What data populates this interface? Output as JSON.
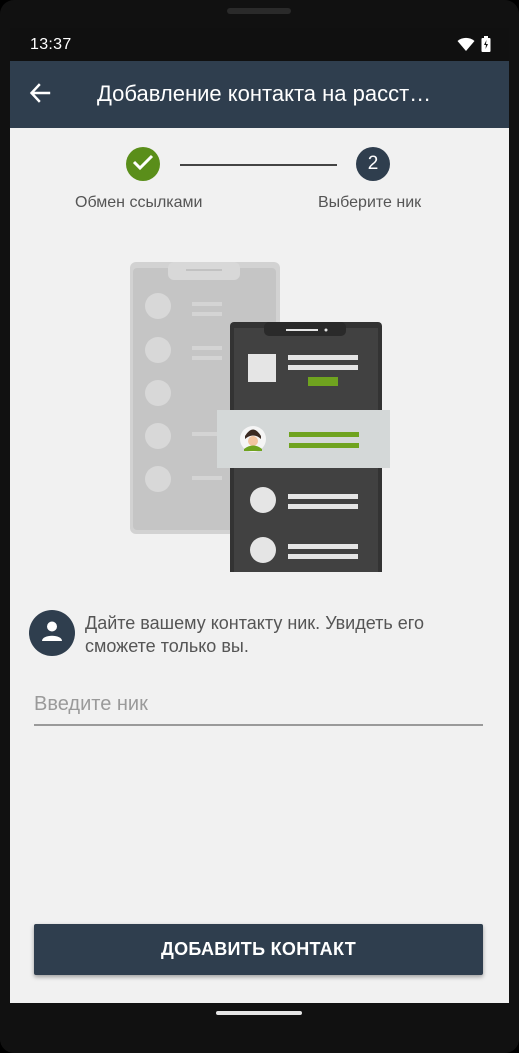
{
  "status_bar": {
    "time": "13:37",
    "icons": [
      "wifi-icon",
      "battery-icon"
    ]
  },
  "app_bar": {
    "back_icon": "arrow-left-icon",
    "title": "Добавление контакта на расст…"
  },
  "stepper": {
    "steps": [
      {
        "label": "Обмен ссылками",
        "state": "completed",
        "icon": "check-icon"
      },
      {
        "label": "Выберите ник",
        "state": "active",
        "number": "2"
      }
    ],
    "colors": {
      "completed": "#5a8e1a",
      "active": "#2f3e4e"
    }
  },
  "illustration": {
    "icon": "add-contact-phones-illustration"
  },
  "info": {
    "icon": "person-icon",
    "text": "Дайте вашему контакту ник. Увидеть его сможете только вы."
  },
  "nick_input": {
    "placeholder": "Введите ник",
    "value": ""
  },
  "add_button": {
    "label": "ДОБАВИТЬ КОНТАКТ"
  },
  "colors": {
    "primary": "#2f3e4e",
    "accent": "#5a8e1a",
    "background": "#f1f1f1"
  }
}
